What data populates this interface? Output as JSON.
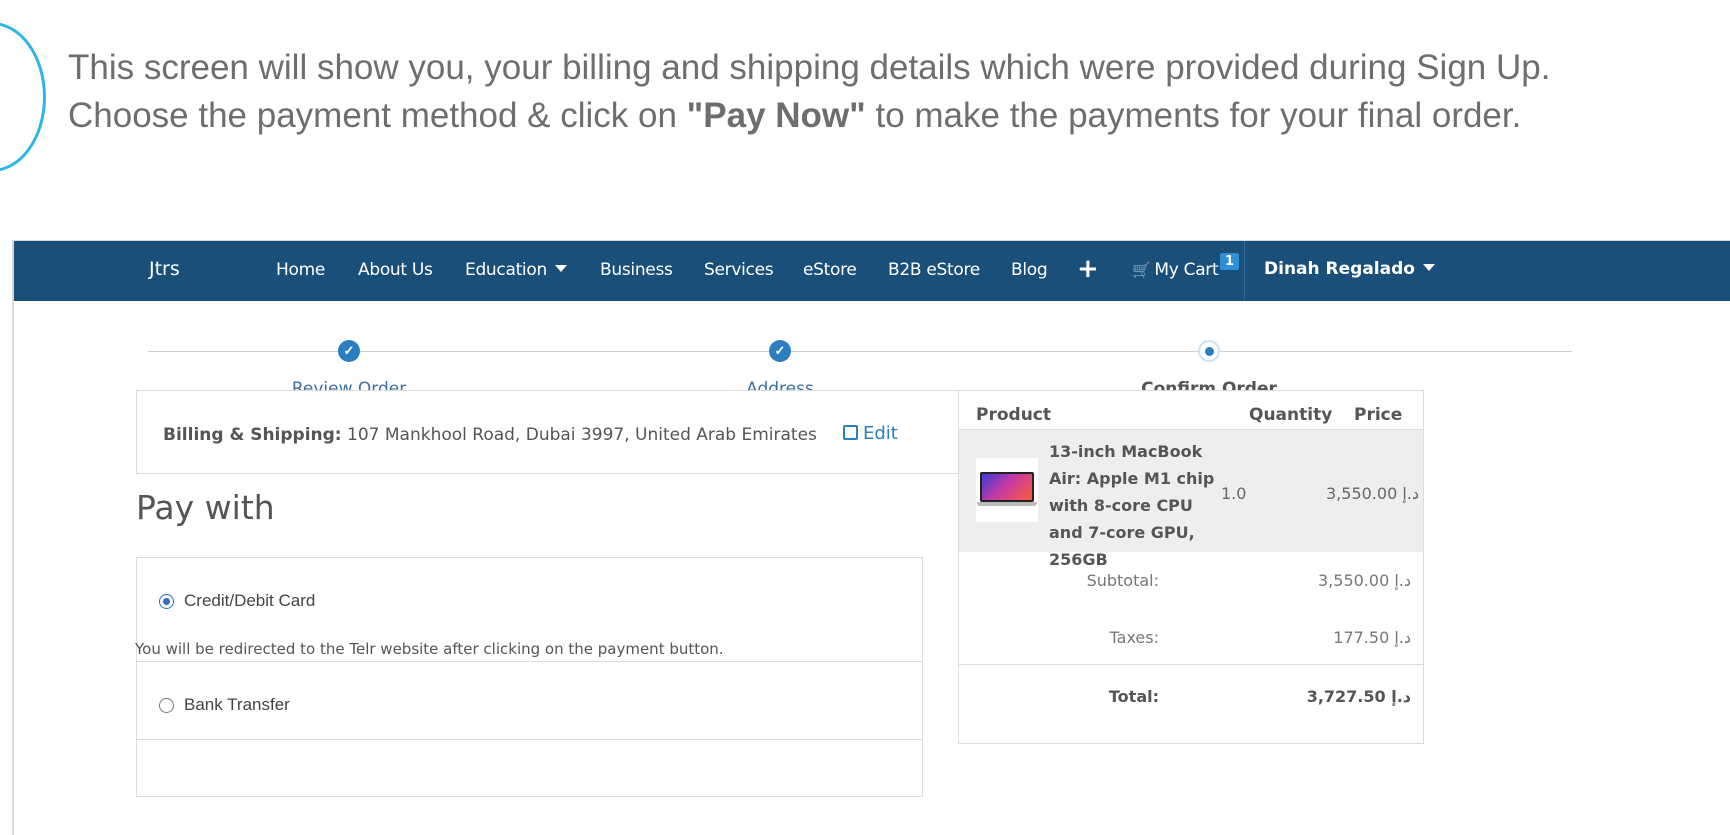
{
  "intro": {
    "line1": "This screen will show you, your billing and shipping details which were provided during Sign Up.",
    "line2_before": "Choose the payment method & click on ",
    "line2_bold": "\"Pay Now\"",
    "line2_after": " to make the payments for your final order."
  },
  "navbar": {
    "brand": "Jtrs",
    "links": [
      "Home",
      "About Us",
      "Education",
      "Business",
      "Services",
      "eStore",
      "B2B eStore",
      "Blog"
    ],
    "plus": "+",
    "cart_label": "My Cart",
    "cart_count": "1",
    "user": "Dinah Regalado"
  },
  "stepper": {
    "steps": [
      "Review Order",
      "Address",
      "Confirm Order"
    ]
  },
  "billing": {
    "label": "Billing & Shipping:",
    "address": " 107 Mankhool Road, Dubai 3997, United Arab Emirates",
    "edit": "Edit"
  },
  "pay_with": {
    "title": "Pay with",
    "options": [
      {
        "label": "Credit/Debit Card",
        "selected": true,
        "note": "You will be redirected to the Telr website after clicking on the payment button."
      },
      {
        "label": "Bank Transfer",
        "selected": false
      }
    ]
  },
  "summary": {
    "headers": {
      "product": "Product",
      "quantity": "Quantity",
      "price": "Price"
    },
    "items": [
      {
        "name": "13-inch MacBook Air: Apple M1 chip with 8-core CPU and 7-core GPU, 256GB",
        "quantity": "1.0",
        "price": "3,550.00 د.إ"
      }
    ],
    "subtotal_label": "Subtotal:",
    "subtotal": "3,550.00 د.إ",
    "taxes_label": "Taxes:",
    "taxes": "177.50 د.إ",
    "total_label": "Total:",
    "total": "3,727.50 د.إ"
  },
  "colors": {
    "navbar": "#1a4f7a",
    "accent": "#2a7fc1",
    "deco_circle": "#2bb7e6"
  }
}
